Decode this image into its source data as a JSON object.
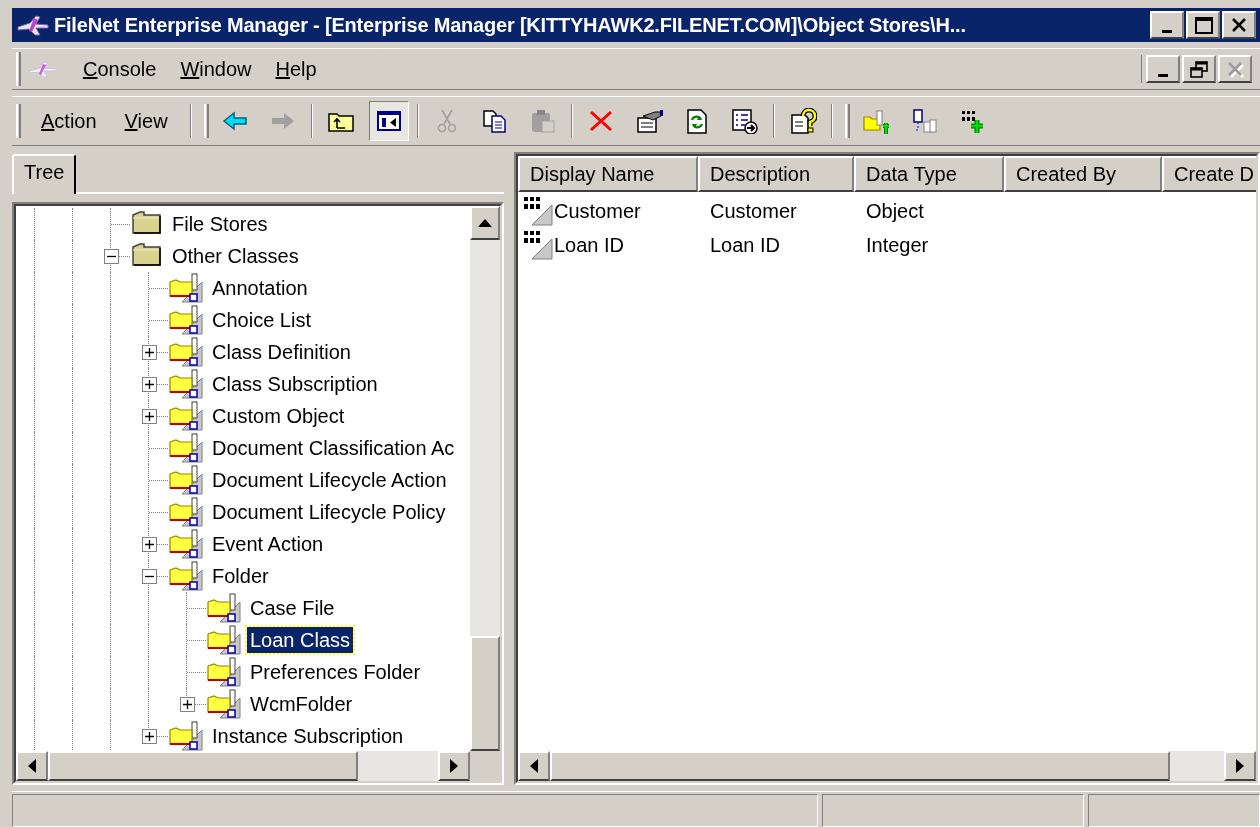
{
  "window": {
    "title": "FileNet Enterprise Manager - [Enterprise Manager [KITTYHAWK2.FILENET.COM]\\Object Stores\\H...",
    "controls": [
      {
        "kind": "minimize",
        "disabled": false
      },
      {
        "kind": "maximize",
        "disabled": false
      },
      {
        "kind": "close",
        "disabled": false
      }
    ]
  },
  "menu": {
    "items": [
      "Console",
      "Window",
      "Help"
    ],
    "mdi_controls": [
      {
        "kind": "minimize",
        "disabled": false
      },
      {
        "kind": "restore",
        "disabled": false
      },
      {
        "kind": "close",
        "disabled": true
      }
    ]
  },
  "toolbar": {
    "menus": [
      "Action",
      "View"
    ],
    "groups": [
      [
        {
          "kind": "back",
          "disabled": false,
          "pressed": false
        },
        {
          "kind": "forward",
          "disabled": true,
          "pressed": false
        }
      ],
      [
        {
          "kind": "up",
          "disabled": false,
          "pressed": false
        },
        {
          "kind": "tree",
          "disabled": false,
          "pressed": true
        }
      ],
      [
        {
          "kind": "cut",
          "disabled": true,
          "pressed": false
        },
        {
          "kind": "copy",
          "disabled": false,
          "pressed": false
        },
        {
          "kind": "paste",
          "disabled": true,
          "pressed": false
        }
      ],
      [
        {
          "kind": "delete",
          "disabled": false,
          "pressed": false
        },
        {
          "kind": "properties",
          "disabled": false,
          "pressed": false
        },
        {
          "kind": "refresh",
          "disabled": false,
          "pressed": false
        },
        {
          "kind": "export",
          "disabled": false,
          "pressed": false
        }
      ],
      [
        {
          "kind": "help",
          "disabled": false,
          "pressed": false
        }
      ],
      [
        {
          "kind": "new_class",
          "disabled": false,
          "pressed": false
        },
        {
          "kind": "new_subclass",
          "disabled": false,
          "pressed": false
        },
        {
          "kind": "new_property",
          "disabled": false,
          "pressed": false
        }
      ]
    ]
  },
  "tabs": [
    {
      "label": "Tree",
      "selected": true
    }
  ],
  "tree": {
    "items": [
      {
        "label": "File Stores",
        "kind": "folder",
        "selected": false
      },
      {
        "label": "Other Classes",
        "kind": "folder",
        "selected": false,
        "expanded": true,
        "children": [
          {
            "label": "Annotation",
            "kind": "class",
            "selected": false
          },
          {
            "label": "Choice List",
            "kind": "class",
            "selected": false
          },
          {
            "label": "Class Definition",
            "kind": "class",
            "selected": false,
            "expanded": false
          },
          {
            "label": "Class Subscription",
            "kind": "class",
            "selected": false,
            "expanded": false
          },
          {
            "label": "Custom Object",
            "kind": "class",
            "selected": false,
            "expanded": false
          },
          {
            "label": "Document Classification Ac",
            "kind": "class",
            "selected": false
          },
          {
            "label": "Document Lifecycle Action",
            "kind": "class",
            "selected": false
          },
          {
            "label": "Document Lifecycle Policy",
            "kind": "class",
            "selected": false
          },
          {
            "label": "Event Action",
            "kind": "class",
            "selected": false,
            "expanded": false
          },
          {
            "label": "Folder",
            "kind": "class",
            "selected": false,
            "expanded": true,
            "children": [
              {
                "label": "Case File",
                "kind": "class",
                "selected": false
              },
              {
                "label": "Loan Class",
                "kind": "class",
                "selected": true
              },
              {
                "label": "Preferences Folder",
                "kind": "class",
                "selected": false
              },
              {
                "label": "WcmFolder",
                "kind": "class",
                "selected": false,
                "expanded": false
              }
            ]
          },
          {
            "label": "Instance Subscription",
            "kind": "class",
            "selected": false,
            "expanded": false
          }
        ]
      }
    ]
  },
  "list": {
    "columns": [
      "Display Name",
      "Description",
      "Data Type",
      "Created By",
      "Create D"
    ],
    "rows": [
      {
        "cells": [
          "Customer",
          "Customer",
          "Object"
        ]
      },
      {
        "cells": [
          "Loan ID",
          "Loan ID",
          "Integer"
        ]
      }
    ]
  }
}
